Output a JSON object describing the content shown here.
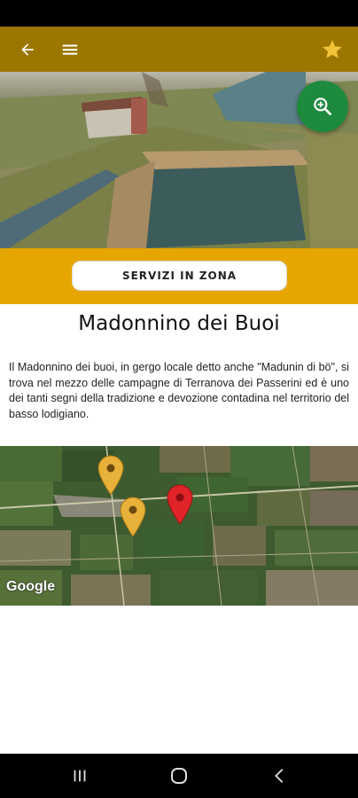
{
  "header": {
    "back_icon": "arrow-left-icon",
    "menu_icon": "hamburger-menu-icon",
    "favorite_icon": "star-icon",
    "bar_color": "#9c7700",
    "star_color": "#f2c237"
  },
  "hero": {
    "zoom_icon": "zoom-in-icon",
    "fab_color": "#1e8a3e"
  },
  "services": {
    "button_label": "SERVIZI IN ZONA",
    "band_color": "#e6a600"
  },
  "place": {
    "title": "Madonnino dei Buoi",
    "description": "Il Madonnino dei buoi, in gergo locale detto anche \"Madunin di bö\", si trova nel mezzo delle campagne di Terranova dei Passerini ed è uno dei tanti segni della tradizione e devozione contadina nel territorio del basso lodigiano."
  },
  "map": {
    "attribution": "Google",
    "markers": [
      {
        "name": "poi-marker-1",
        "color": "#e8b13a"
      },
      {
        "name": "poi-marker-2",
        "color": "#e8b13a"
      },
      {
        "name": "selected-location-marker",
        "color": "#e0242a"
      }
    ]
  },
  "system_nav": {
    "recents_icon": "recents-icon",
    "home_icon": "home-icon",
    "back_icon": "back-chevron-icon"
  }
}
